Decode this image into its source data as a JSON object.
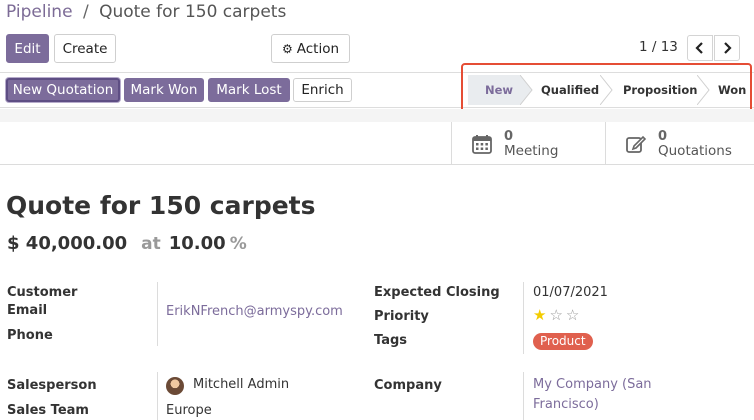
{
  "breadcrumb": {
    "parent": "Pipeline",
    "separator": "/",
    "current": "Quote for 150 carpets"
  },
  "toolbar": {
    "edit_label": "Edit",
    "create_label": "Create",
    "action_label": "Action"
  },
  "pager": {
    "text": "1 / 13"
  },
  "status_buttons": {
    "new_quotation": "New Quotation",
    "mark_won": "Mark Won",
    "mark_lost": "Mark Lost",
    "enrich": "Enrich"
  },
  "stages": [
    {
      "label": "New",
      "active": true
    },
    {
      "label": "Qualified",
      "active": false
    },
    {
      "label": "Proposition",
      "active": false
    },
    {
      "label": "Won",
      "active": false
    }
  ],
  "smart_buttons": {
    "meeting": {
      "count": "0",
      "label": "Meeting",
      "icon": "calendar-icon"
    },
    "quotations": {
      "count": "0",
      "label": "Quotations",
      "icon": "edit-icon"
    }
  },
  "record": {
    "title": "Quote for 150 carpets",
    "revenue": "$ 40,000.00",
    "at": "at",
    "probability": "10.00",
    "percent": "%"
  },
  "fields": {
    "customer_label": "Customer",
    "email_label": "Email",
    "email_value": "ErikNFrench@armyspy.com",
    "phone_label": "Phone",
    "expected_closing_label": "Expected Closing",
    "expected_closing_value": "01/07/2021",
    "priority_label": "Priority",
    "priority_value": 1,
    "priority_max": 3,
    "tags_label": "Tags",
    "tag_value": "Product",
    "salesperson_label": "Salesperson",
    "salesperson_value": "Mitchell Admin",
    "sales_team_label": "Sales Team",
    "sales_team_value": "Europe",
    "company_label": "Company",
    "company_value_line1": "My Company (San",
    "company_value_line2": "Francisco)"
  },
  "colors": {
    "primary": "#7c6c9b",
    "highlight": "#e54d35",
    "tag": "#e0604e",
    "star": "#f3cc00"
  }
}
